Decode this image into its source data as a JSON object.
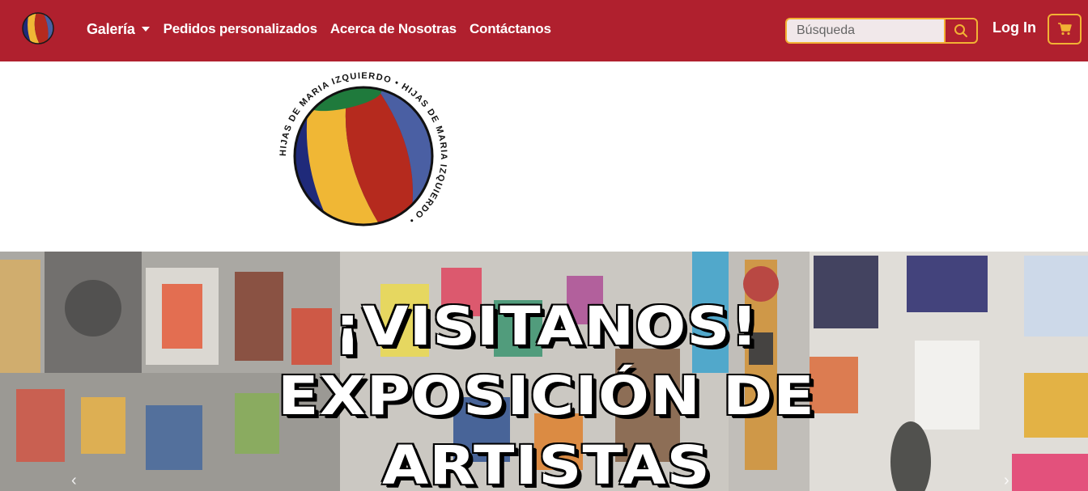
{
  "nav": {
    "items": [
      {
        "label": "Galería",
        "has_dropdown": true
      },
      {
        "label": "Pedidos personalizados"
      },
      {
        "label": "Acerca de Nosotras"
      },
      {
        "label": "Contáctanos"
      }
    ],
    "search_placeholder": "Búsqueda",
    "login_label": "Log In",
    "icons": {
      "search": "search-icon",
      "cart": "cart-icon",
      "logo": "ball-logo-icon"
    }
  },
  "brand": {
    "ring_text": "HIJAS DE MARIA IZQUIERDO • HIJAS DE MARIA IZQUIERDO •"
  },
  "hero": {
    "lines": [
      "¡VISITANOS!",
      "EXPOSICIÓN DE",
      "ARTISTAS"
    ]
  },
  "colors": {
    "navbar": "#b0202e",
    "accent": "#f2b234",
    "logo_blue": "#1f2a7a",
    "logo_yellow": "#f0b735",
    "logo_red": "#b52a1e",
    "logo_slate": "#4a5fa3",
    "logo_green": "#1f7a3c"
  }
}
